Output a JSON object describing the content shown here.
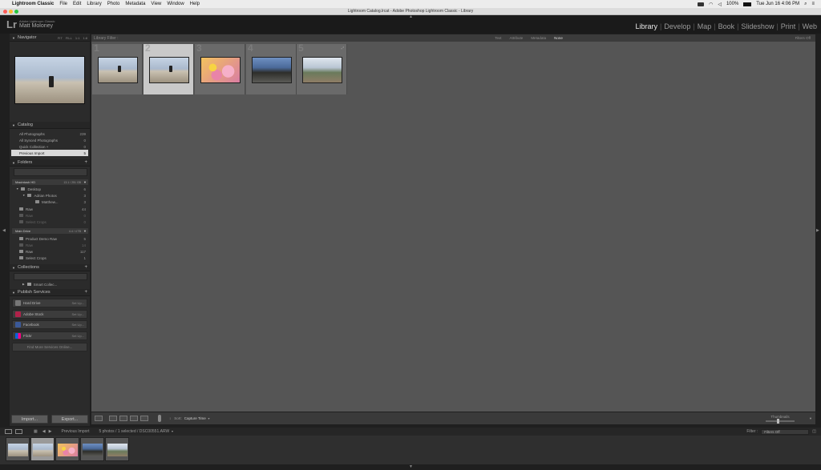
{
  "menubar": {
    "app_name": "Lightroom Classic",
    "items": [
      "File",
      "Edit",
      "Library",
      "Photo",
      "Metadata",
      "View",
      "Window",
      "Help"
    ],
    "battery": "100%",
    "datetime": "Tue Jun 16  4:06 PM"
  },
  "window": {
    "title": "Lightroom Catalog.lrcat - Adobe Photoshop Lightroom Classic - Library"
  },
  "identity": {
    "logo": "Lr",
    "product": "Adobe Lightroom Classic",
    "user": "Matt Moloney"
  },
  "modules": [
    {
      "label": "Library",
      "active": true
    },
    {
      "label": "Develop",
      "active": false
    },
    {
      "label": "Map",
      "active": false
    },
    {
      "label": "Book",
      "active": false
    },
    {
      "label": "Slideshow",
      "active": false
    },
    {
      "label": "Print",
      "active": false
    },
    {
      "label": "Web",
      "active": false
    }
  ],
  "navigator": {
    "title": "Navigator",
    "zoom_options": [
      "FIT",
      "FILL",
      "1:1",
      "1:8"
    ]
  },
  "catalog": {
    "title": "Catalog",
    "items": [
      {
        "label": "All Photographs",
        "count": "239"
      },
      {
        "label": "All Synced Photographs",
        "count": "0"
      },
      {
        "label": "Quick Collection +",
        "count": "0"
      },
      {
        "label": "Previous Import",
        "count": "5"
      }
    ]
  },
  "folders": {
    "title": "Folders",
    "volumes": [
      {
        "label": "Macintosh HD",
        "info": "13.1 / 251 GB"
      },
      {
        "label": "Main Drive",
        "info": "4.4 / 4 TB"
      }
    ],
    "mac_items": [
      {
        "label": "Desktop",
        "count": "6"
      },
      {
        "label": "Adrian Photos",
        "count": "3"
      },
      {
        "label": "Matthew...",
        "count": "3"
      },
      {
        "label": "Raw",
        "count": "44"
      },
      {
        "label": "Raw",
        "count": "0"
      },
      {
        "label": "Select Crops",
        "count": "0"
      }
    ],
    "drive_items": [
      {
        "label": "Product Demo Raw",
        "count": "5"
      },
      {
        "label": "Raw",
        "count": "14"
      },
      {
        "label": "Raw",
        "count": "117"
      },
      {
        "label": "Select Crops",
        "count": "1"
      }
    ]
  },
  "collections": {
    "title": "Collections",
    "items": [
      {
        "label": "Smart Collec..."
      }
    ]
  },
  "publish": {
    "title": "Publish Services",
    "services": [
      {
        "label": "Hard Drive",
        "setup": "Set Up...",
        "color": "#777777"
      },
      {
        "label": "Adobe Stock",
        "setup": "Set Up...",
        "color": "#b0224a"
      },
      {
        "label": "Facebook",
        "setup": "Set Up...",
        "color": "#3b5998"
      },
      {
        "label": "Flickr",
        "setup": "Set Up...",
        "color": "#ff0084"
      }
    ],
    "find_more": "Find More Services Online..."
  },
  "buttons": {
    "import": "Import...",
    "export": "Export..."
  },
  "filter_bar": {
    "title": "Library Filter :",
    "tabs": [
      "Text",
      "Attribute",
      "Metadata",
      "None"
    ],
    "active_tab": "None",
    "status": "Filters Off"
  },
  "grid": {
    "cells": [
      {
        "num": "1",
        "image": "beach1",
        "active": false
      },
      {
        "num": "2",
        "image": "beach1",
        "active": true
      },
      {
        "num": "3",
        "image": "flower",
        "active": false
      },
      {
        "num": "4",
        "image": "street",
        "active": false
      },
      {
        "num": "5",
        "image": "cliff",
        "active": false
      }
    ]
  },
  "toolbar": {
    "sort_label": "Sort:",
    "sort_value": "Capture Time",
    "thumbnails_label": "Thumbnails"
  },
  "filmstrip": {
    "source": "Previous Import",
    "selection": "5 photos / 1 selected / DSC00551.ARW",
    "filter_label": "Filter :",
    "filter_value": "Filters Off"
  }
}
